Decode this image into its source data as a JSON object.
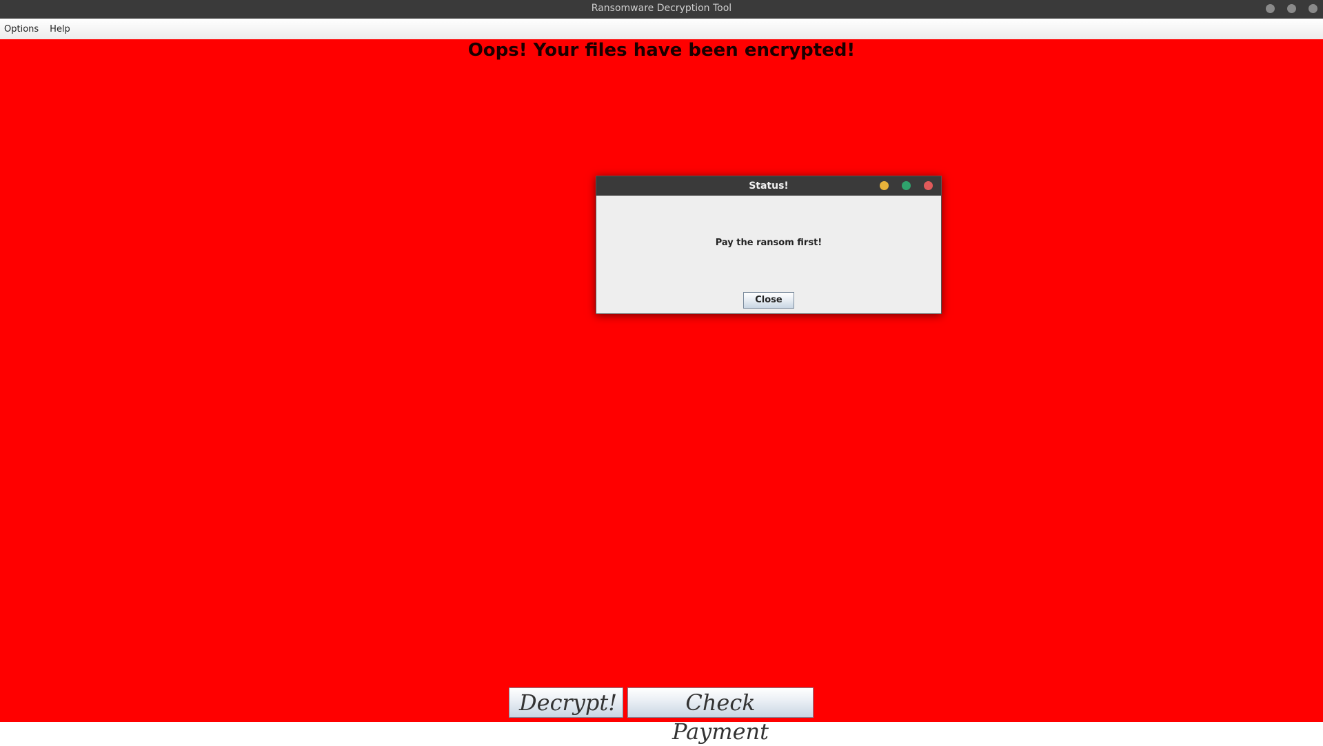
{
  "window": {
    "title": "Ransomware Decryption Tool",
    "controls": [
      "minimize-icon",
      "maximize-icon",
      "close-icon"
    ]
  },
  "menubar": {
    "items": [
      "Options",
      "Help"
    ]
  },
  "main": {
    "headline": "Oops! Your files have been encrypted!",
    "buttons": {
      "decrypt": "Decrypt!",
      "check_payment": "Check Payment"
    }
  },
  "dialog": {
    "title": "Status!",
    "message": "Pay the ransom first!",
    "close_label": "Close",
    "controls": [
      {
        "icon": "minimize-icon",
        "color": "#e8b33a"
      },
      {
        "icon": "maximize-icon",
        "color": "#2fa36d"
      },
      {
        "icon": "close-icon",
        "color": "#e05a5a"
      }
    ]
  },
  "colors": {
    "background": "#ff0000",
    "titlebar": "#3a3a3a"
  }
}
